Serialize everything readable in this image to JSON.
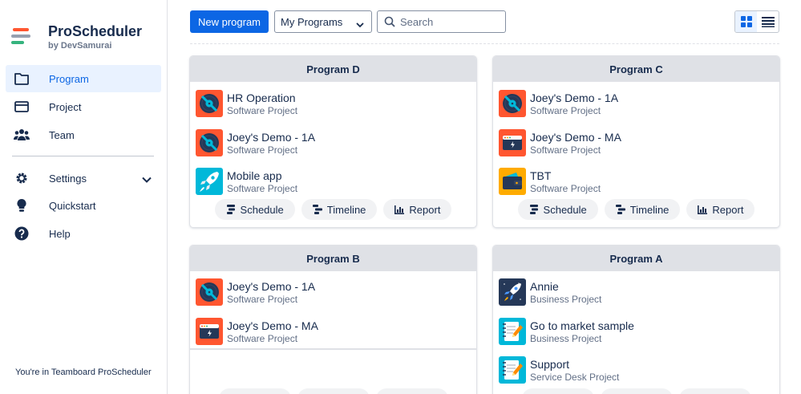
{
  "brand": {
    "title": "ProScheduler",
    "subtitle": "by DevSamurai"
  },
  "nav": {
    "program": "Program",
    "project": "Project",
    "team": "Team",
    "settings": "Settings",
    "quickstart": "Quickstart",
    "help": "Help"
  },
  "footer": "You're in Teamboard ProScheduler",
  "toolbar": {
    "new_program": "New program",
    "filter_value": "My Programs",
    "search_placeholder": "Search"
  },
  "cards": [
    {
      "title": "Program D",
      "projects": [
        {
          "name": "HR Operation",
          "type": "Software Project",
          "icon": "vinyl"
        },
        {
          "name": "Joey's Demo - 1A",
          "type": "Software Project",
          "icon": "vinyl"
        },
        {
          "name": "Mobile app",
          "type": "Software Project",
          "icon": "rocket-light"
        }
      ],
      "actions": [
        "Schedule",
        "Timeline",
        "Report"
      ]
    },
    {
      "title": "Program C",
      "projects": [
        {
          "name": "Joey's Demo - 1A",
          "type": "Software Project",
          "icon": "vinyl"
        },
        {
          "name": "Joey's Demo - MA",
          "type": "Software Project",
          "icon": "browser"
        },
        {
          "name": "TBT",
          "type": "Software Project",
          "icon": "wallet"
        }
      ],
      "actions": [
        "Schedule",
        "Timeline",
        "Report"
      ]
    },
    {
      "title": "Program B",
      "projects": [
        {
          "name": "Joey's Demo - 1A",
          "type": "Software Project",
          "icon": "vinyl"
        },
        {
          "name": "Joey's Demo - MA",
          "type": "Software Project",
          "icon": "browser"
        }
      ]
    },
    {
      "title": "Program A",
      "projects": [
        {
          "name": "Annie",
          "type": "Business Project",
          "icon": "rocket-dark"
        },
        {
          "name": "Go to market sample",
          "type": "Business Project",
          "icon": "notebook"
        },
        {
          "name": "Support",
          "type": "Service Desk Project",
          "icon": "notebook"
        }
      ]
    }
  ],
  "colors": {
    "primary": "#0c66e4",
    "active_bg": "#e9f2ff",
    "header_bg": "#dfe1e6"
  }
}
